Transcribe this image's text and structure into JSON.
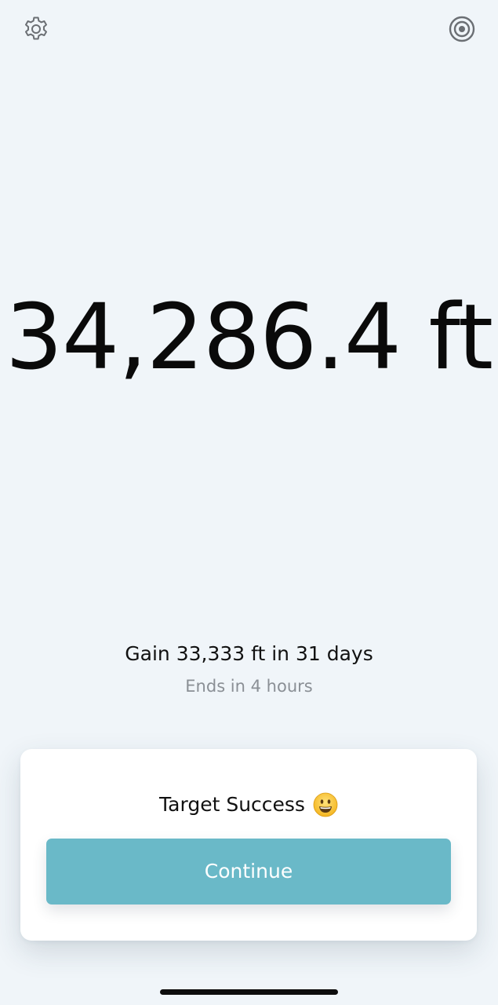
{
  "header": {
    "settings_icon": "gear-icon",
    "target_icon": "target-icon"
  },
  "main": {
    "total_value": "34,286.4 ft",
    "goal": "Gain 33,333 ft in 31 days",
    "ends": "Ends in 4 hours"
  },
  "result_card": {
    "title": "Target Success",
    "emoji": "smiling-face-emoji",
    "continue_label": "Continue"
  },
  "colors": {
    "background": "#f0f5f9",
    "accent": "#6ab9c8",
    "secondary_text": "#8a8f95"
  }
}
